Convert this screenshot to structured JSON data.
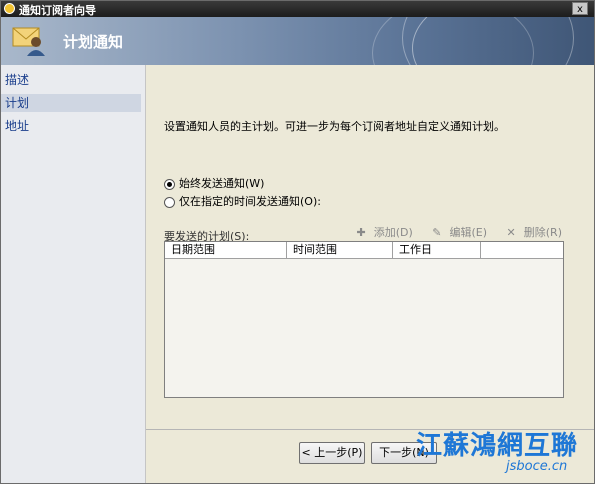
{
  "window": {
    "title": "通知订阅者向导",
    "close_label": "x"
  },
  "banner": {
    "title": "计划通知"
  },
  "nav": {
    "items": [
      {
        "label": "描述"
      },
      {
        "label": "计划"
      },
      {
        "label": "地址"
      }
    ]
  },
  "main": {
    "description": "设置通知人员的主计划。可进一步为每个订阅者地址自定义通知计划。",
    "radio_always": "始终发送通知(W)",
    "radio_specific": "仅在指定的时间发送通知(O):",
    "schedule_label": "要发送的计划(S):",
    "toolbar": {
      "add": "添加(D)",
      "edit": "编辑(E)",
      "delete": "删除(R)"
    },
    "columns": [
      "日期范围",
      "时间范围",
      "工作日"
    ]
  },
  "footer": {
    "back": "< 上一步(P)",
    "next": "下一步(N)"
  },
  "watermark": {
    "line1": "江蘇鴻網互聯",
    "line2": "jsboce.cn"
  },
  "colors": {
    "nav_text": "#1a3e8c",
    "watermark": "#1e77d6"
  }
}
